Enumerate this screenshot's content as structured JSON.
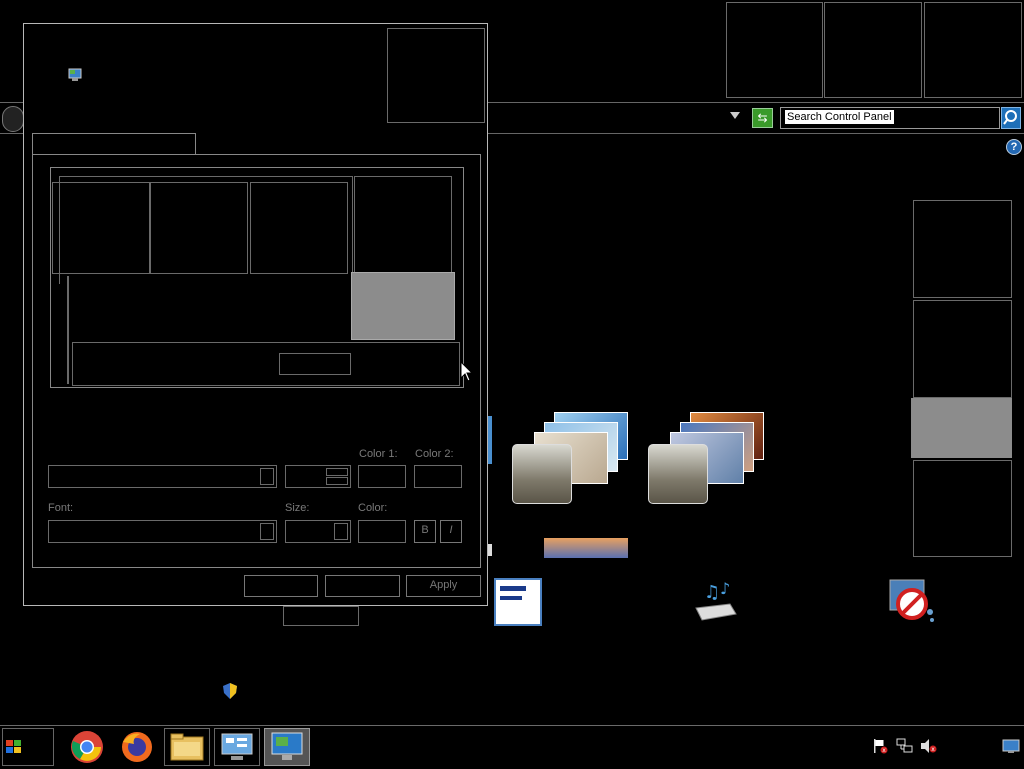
{
  "window": {
    "search_placeholder": "Search Control Panel",
    "help_glyph": "?"
  },
  "dialog": {
    "labels": {
      "color1": "Color 1:",
      "color2": "Color 2:",
      "font": "Font:",
      "size": "Size:",
      "color": "Color:",
      "bold": "B",
      "italic": "I"
    },
    "buttons": {
      "ok": "",
      "cancel": "",
      "apply": "Apply"
    }
  },
  "colors": {
    "preview_selected": "#8c8c8c",
    "search_button": "#1e6fb8",
    "help_icon": "#2468b3"
  }
}
